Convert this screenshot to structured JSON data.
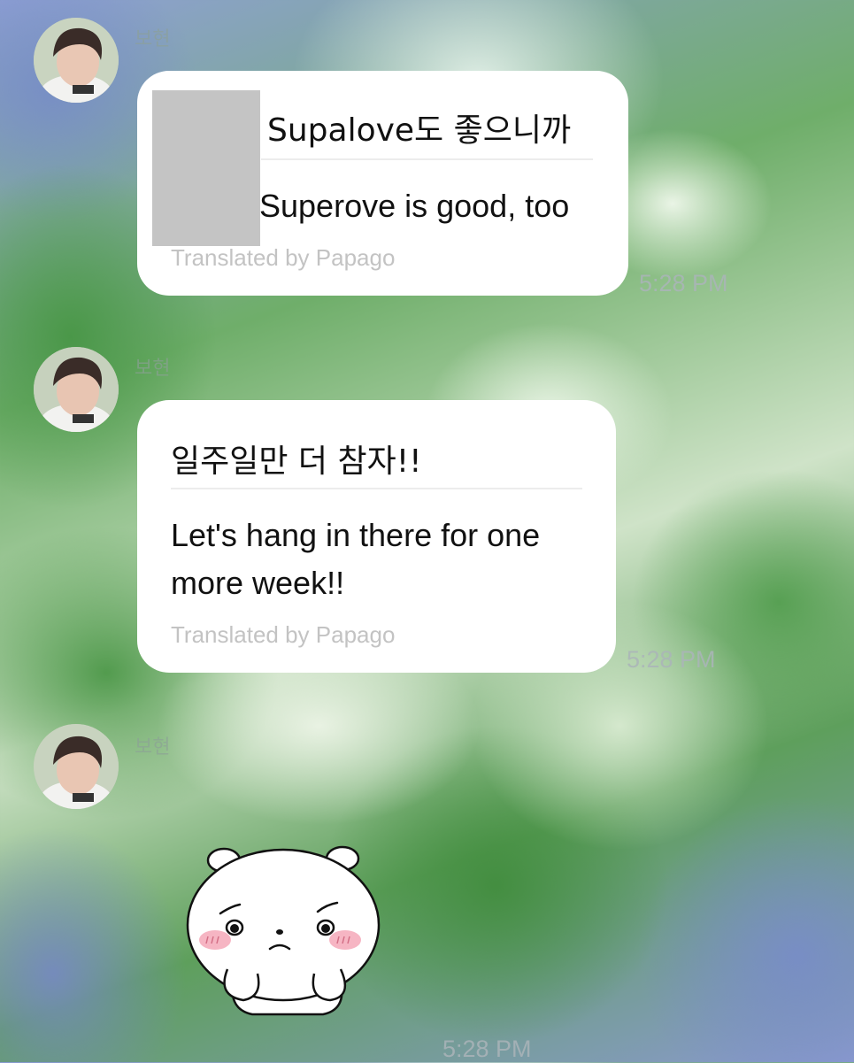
{
  "messages": [
    {
      "sender": "보현",
      "original": "Supalove도 좋으니까",
      "translation": "Superove is good, too",
      "translated_by": "Translated by Papago",
      "time": "5:28 PM"
    },
    {
      "sender": "보현",
      "original": "일주일만 더 참자!!",
      "translation_line1": "Let's hang in there for one",
      "translation_line2": "more week!!",
      "translated_by": "Translated by Papago",
      "time": "5:28 PM"
    },
    {
      "sender": "보현",
      "sticker": "crying-bear-sticker",
      "time": "5:28 PM"
    }
  ],
  "colors": {
    "bubble": "#ffffff",
    "text": "#111111",
    "muted": "#c3c3c3",
    "blush": "#f4a8b8"
  }
}
